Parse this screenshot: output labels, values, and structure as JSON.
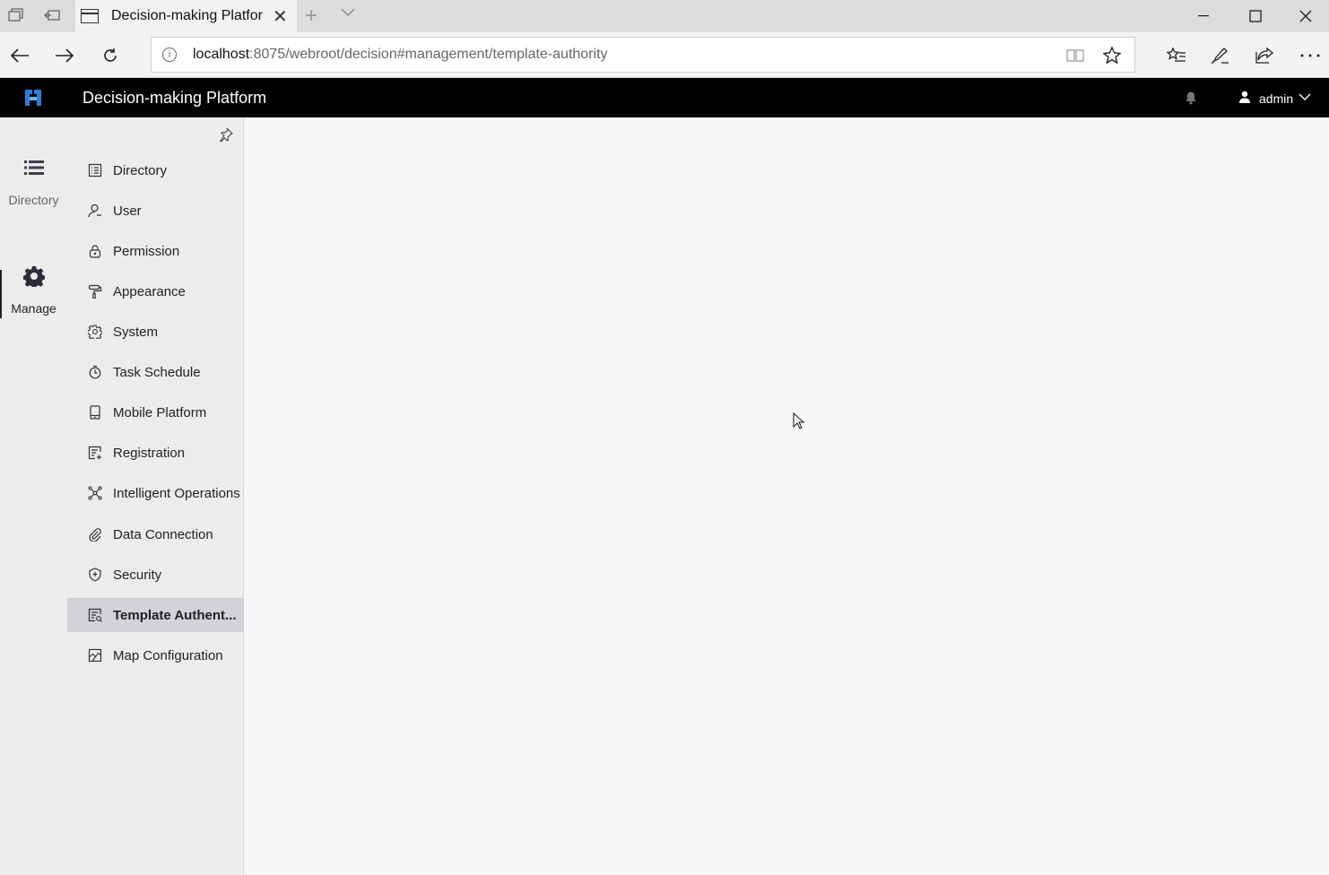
{
  "browser": {
    "tab_title": "Decision-making Platform",
    "url_host": "localhost",
    "url_rest": ":8075/webroot/decision#management/template-authority"
  },
  "app": {
    "title": "Decision-making Platform",
    "user": "admin",
    "accent": "#000000"
  },
  "rail": {
    "items": [
      {
        "label": "Directory",
        "icon": "list-icon"
      },
      {
        "label": "Manage",
        "icon": "gear-icon",
        "active": true
      }
    ]
  },
  "menu": {
    "items": [
      {
        "label": "Directory",
        "icon": "directory-icon"
      },
      {
        "label": "User",
        "icon": "user-icon"
      },
      {
        "label": "Permission",
        "icon": "lock-icon"
      },
      {
        "label": "Appearance",
        "icon": "paint-roller-icon"
      },
      {
        "label": "System",
        "icon": "gear-icon"
      },
      {
        "label": "Task Schedule",
        "icon": "timer-icon"
      },
      {
        "label": "Mobile Platform",
        "icon": "mobile-icon"
      },
      {
        "label": "Registration",
        "icon": "registration-icon"
      },
      {
        "label": "Intelligent Operations",
        "icon": "network-icon"
      },
      {
        "label": "Data Connection",
        "icon": "paperclip-icon"
      },
      {
        "label": "Security",
        "icon": "shield-icon"
      },
      {
        "label": "Template Authent...",
        "icon": "template-icon",
        "active": true
      },
      {
        "label": "Map Configuration",
        "icon": "map-icon"
      }
    ]
  }
}
